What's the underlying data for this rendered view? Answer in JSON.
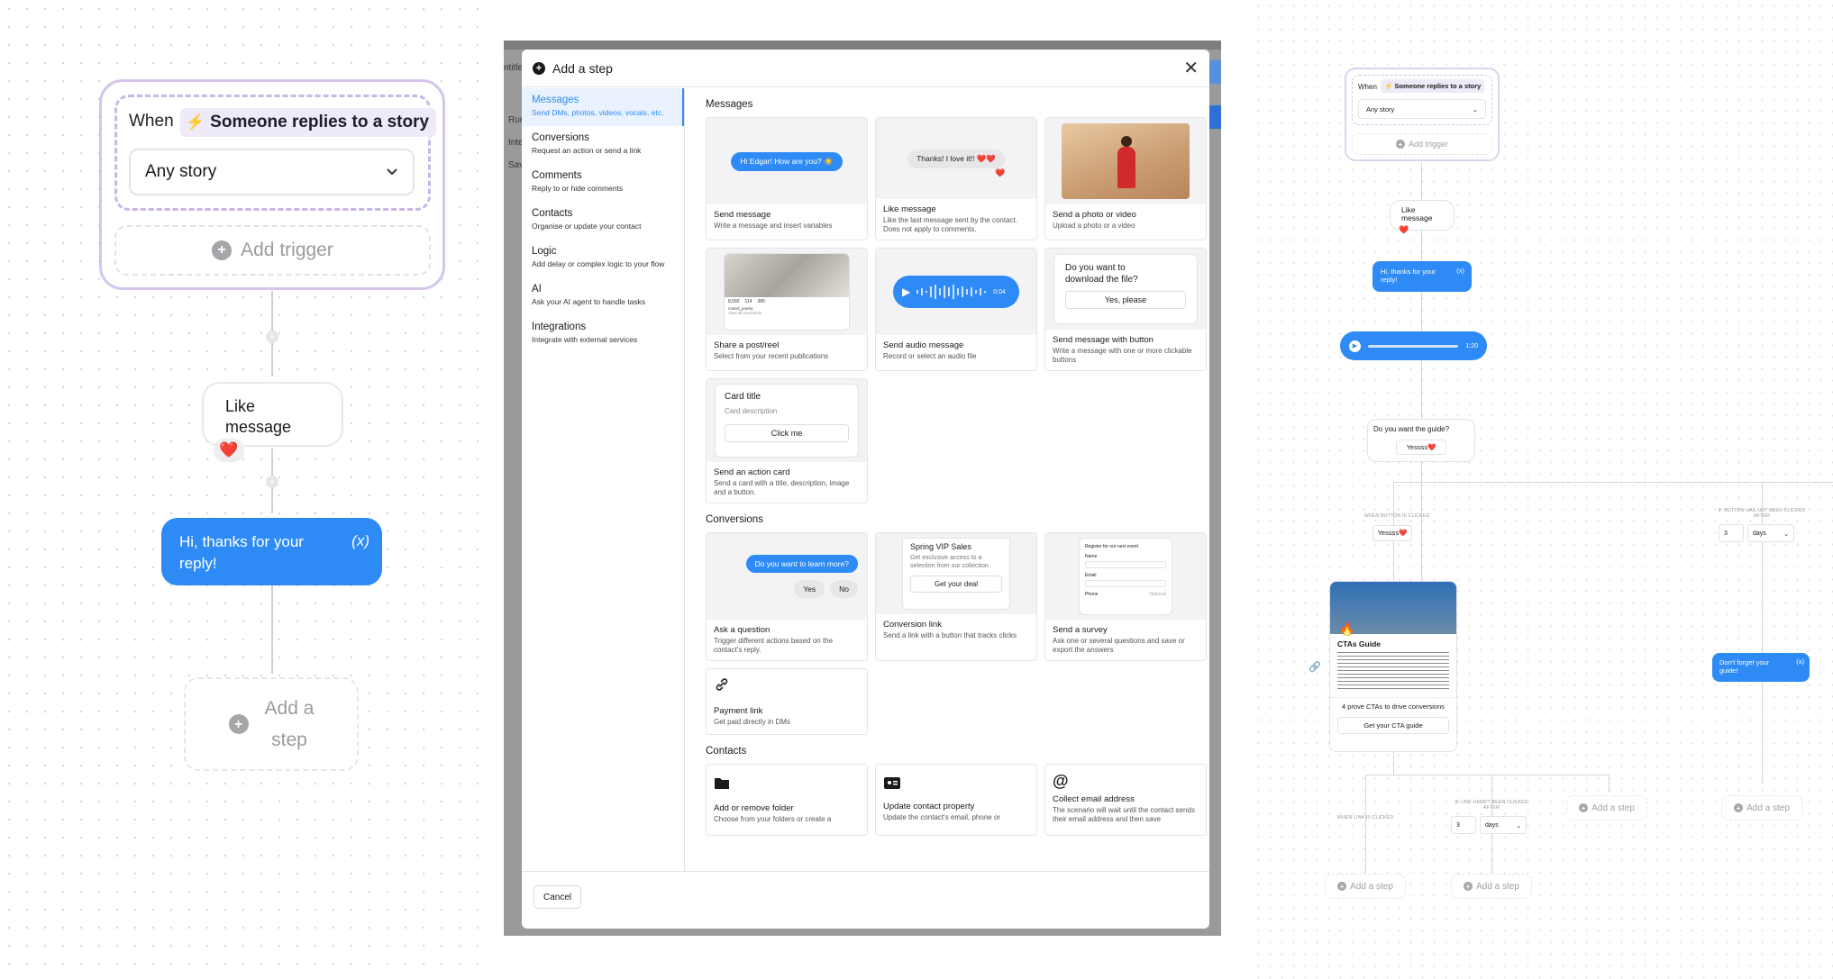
{
  "left": {
    "trigger": {
      "when_label": "When",
      "event_label": "Someone replies to a story",
      "select_value": "Any story",
      "add_trigger_label": "Add trigger"
    },
    "like_message": {
      "label_line1": "Like",
      "label_line2": "message"
    },
    "reply_bubble": {
      "text": "Hi, thanks for your reply!",
      "var_icon_label": "(x)"
    },
    "add_step": {
      "line1": "Add a",
      "line2": "step"
    }
  },
  "modal": {
    "title": "Add a step",
    "background_labels": [
      "ntitle",
      "Run",
      "Inte",
      "Sav"
    ],
    "sidebar": [
      {
        "title": "Messages",
        "desc": "Send DMs, photos, videos, vocals, etc.",
        "active": true
      },
      {
        "title": "Conversions",
        "desc": "Request an action or send a link",
        "active": false
      },
      {
        "title": "Comments",
        "desc": "Reply to or hide comments",
        "active": false
      },
      {
        "title": "Contacts",
        "desc": "Organise or update your contact",
        "active": false
      },
      {
        "title": "Logic",
        "desc": "Add delay or complex logic to your flow",
        "active": false
      },
      {
        "title": "AI",
        "desc": "Ask your AI agent to handle tasks",
        "active": false
      },
      {
        "title": "Integrations",
        "desc": "Integrate with external services",
        "active": false
      }
    ],
    "sections": {
      "messages": "Messages",
      "conversions": "Conversions",
      "contacts": "Contacts"
    },
    "cards": {
      "send_message": {
        "title": "Send message",
        "desc": "Write a message and insert variables",
        "preview": "Hi Edgar! How are you? ☀️"
      },
      "like_message": {
        "title": "Like message",
        "desc": "Like the last message sent by the contact. Does not apply to comments.",
        "preview": "Thanks! I love it!! ❤️❤️"
      },
      "send_photo": {
        "title": "Send a photo or video",
        "desc": "Upload a photo or a video"
      },
      "share_post": {
        "title": "Share a post/reel",
        "desc": "Select from your recent publications",
        "stats": [
          "8,092",
          "114",
          "380"
        ],
        "caption": "muted_poetry",
        "more": "View all comments"
      },
      "send_audio": {
        "title": "Send audio message",
        "desc": "Record or select an audio file",
        "time": "0:04"
      },
      "send_button": {
        "title": "Send message with button",
        "desc": "Write a message with one or more clickable buttons",
        "question": "Do you want to download the file?",
        "button": "Yes, please"
      },
      "action_card": {
        "title": "Send an action card",
        "desc": "Send a card with a title, description, image and a button.",
        "card_title": "Card title",
        "card_desc": "Card description",
        "card_button": "Click me"
      },
      "ask_question": {
        "title": "Ask a question",
        "desc": "Trigger different actions based on the contact's reply.",
        "preview": "Do you want to learn more?",
        "yes": "Yes",
        "no": "No"
      },
      "conversion_link": {
        "title": "Conversion link",
        "desc": "Send a link with a button that tracks clicks",
        "promo_title": "Spring VIP Sales",
        "promo_desc": "Get exclusive access to a selection from our collection",
        "promo_button": "Get your deal"
      },
      "send_survey": {
        "title": "Send a survey",
        "desc": "Ask one or several questions and save or export the answers",
        "form_title": "Register for our next event",
        "field1": "Name",
        "field2": "Email",
        "field3": "Phone",
        "optional": "Optional"
      },
      "payment_link": {
        "title": "Payment link",
        "desc": "Get paid directly in DMs"
      },
      "add_folder": {
        "title": "Add or remove folder",
        "desc": "Choose from your folders or create a"
      },
      "update_property": {
        "title": "Update contact property",
        "desc": "Update the contact's email, phone or"
      },
      "collect_email": {
        "title": "Collect email address",
        "desc": "The scenario will wait until the contact sends their email address and then save"
      }
    },
    "cancel_label": "Cancel"
  },
  "right": {
    "when_label": "When",
    "event_label": "Someone replies to a story",
    "select_value": "Any story",
    "add_trigger_label": "Add trigger",
    "like_line1": "Like",
    "like_line2": "message",
    "reply_text": "Hi, thanks for your reply!",
    "var_label": "(x)",
    "audio_time": "1:20",
    "question": "Do you want the guide?",
    "answer": "Yessss❤️",
    "when_button_clicked": "WHEN BUTTON IS CLICKED",
    "if_not_clicked": "IF BUTTON HAS NOT BEEN CLICKED AFTER",
    "delay_value": "3",
    "delay_unit": "days",
    "cta_title": "CTAs Guide",
    "cta_text": "4 prove CTAs to drive conversions",
    "cta_button": "Get your CTA guide",
    "reminder": "Don't forget your guide!",
    "when_link_clicked": "WHEN LINK IS CLICKED",
    "if_link_not_clicked": "IF LINK HASN'T BEEN CLICKED AFTER",
    "add_step": "Add a step"
  }
}
